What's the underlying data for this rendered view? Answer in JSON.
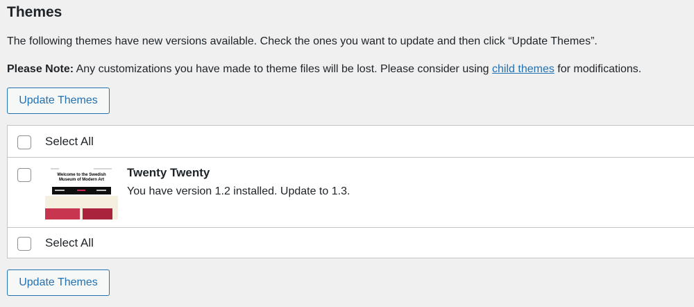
{
  "page": {
    "title": "Themes",
    "notice_line": "The following themes have new versions available. Check the ones you want to update and then click “Update Themes”.",
    "note_label": "Please Note:",
    "note_text": " Any customizations you have made to theme files will be lost. Please consider using ",
    "note_link": "child themes",
    "note_suffix": " for modifications."
  },
  "buttons": {
    "update_top": "Update Themes",
    "update_bottom": "Update Themes"
  },
  "table": {
    "select_all_top": "Select All",
    "select_all_bottom": "Select All",
    "themes": [
      {
        "name": "Twenty Twenty",
        "status": "You have version 1.2 installed. Update to 1.3.",
        "screenshot_heading": "Welcome to the Swedish Museum of Modern Art"
      }
    ]
  },
  "colors": {
    "background": "#f0f0f1",
    "accent": "#2271b1",
    "border": "#c3c4c7"
  }
}
